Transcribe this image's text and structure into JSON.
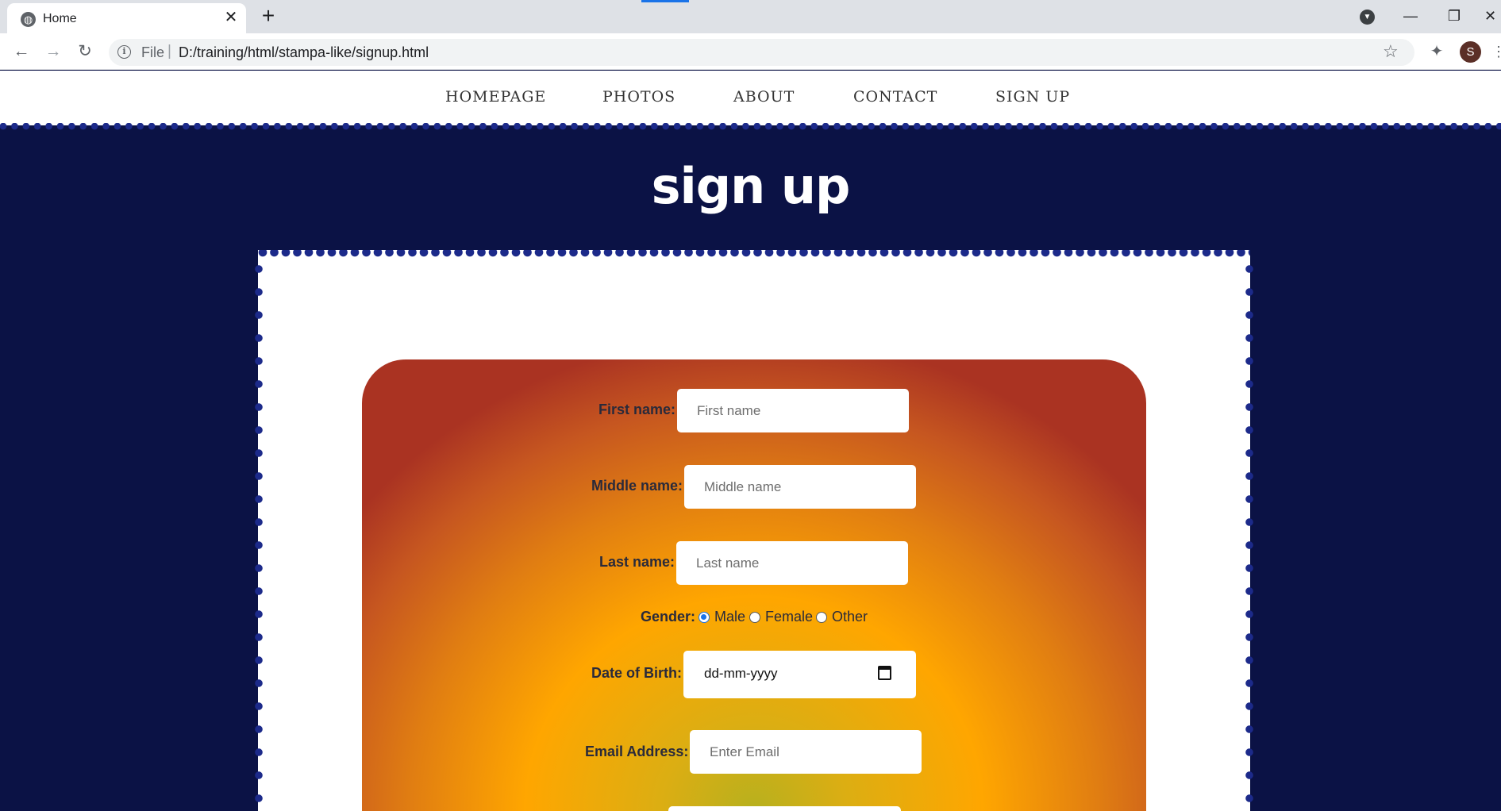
{
  "browser": {
    "tab_title": "Home",
    "new_tab_symbol": "+",
    "url_scheme_label": "File",
    "url_separator": "|",
    "url": "D:/training/html/stampa-like/signup.html",
    "profile_initial": "S",
    "icons": [
      "globe-icon",
      "close-icon",
      "plus-icon",
      "back-icon",
      "forward-icon",
      "reload-icon",
      "info-icon",
      "star-icon",
      "extensions-icon",
      "minimize-icon",
      "restore-icon",
      "close-window-icon"
    ]
  },
  "nav": {
    "items": [
      "HOMEPAGE",
      "PHOTOS",
      "ABOUT",
      "CONTACT",
      "SIGN UP"
    ]
  },
  "page": {
    "title": "sign up"
  },
  "form": {
    "first_name": {
      "label": "First name:",
      "placeholder": "First name",
      "value": ""
    },
    "middle_name": {
      "label": "Middle name:",
      "placeholder": "Middle name",
      "value": ""
    },
    "last_name": {
      "label": "Last name:",
      "placeholder": "Last name",
      "value": ""
    },
    "gender": {
      "label": "Gender:",
      "options": [
        "Male",
        "Female",
        "Other"
      ],
      "selected": "Male"
    },
    "dob": {
      "label": "Date of Birth:",
      "value": "dd-mm-yyyy"
    },
    "email": {
      "label": "Email Address:",
      "placeholder": "Enter Email",
      "value": ""
    }
  },
  "colors": {
    "page_background": "#0b1245",
    "perforation": "#1c2a8a",
    "card_center": "#ffa600",
    "card_edge": "#aa3322",
    "radio_selected": "#1a73e8"
  }
}
